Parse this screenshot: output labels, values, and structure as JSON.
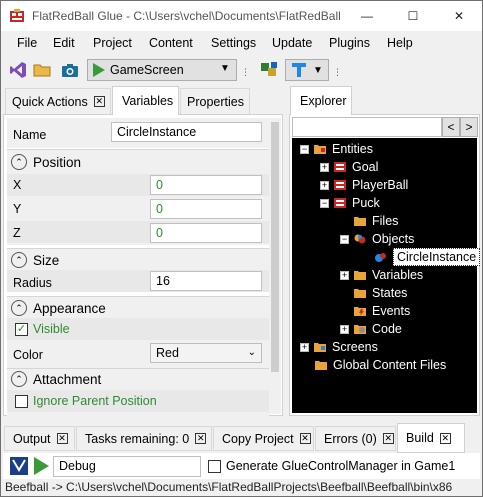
{
  "window": {
    "title": "FlatRedBall Glue - C:\\Users\\vchel\\Documents\\FlatRedBall",
    "minimize": "—",
    "maximize": "☐",
    "close": "✕"
  },
  "menu": [
    "File",
    "Edit",
    "Project",
    "Content",
    "Settings",
    "Update",
    "Plugins",
    "Help"
  ],
  "toolbar": {
    "screen_combo_value": "GameScreen"
  },
  "left_tabs": [
    {
      "label": "Quick Actions",
      "close": "✕"
    },
    {
      "label": "Variables"
    },
    {
      "label": "Properties"
    }
  ],
  "variables": {
    "name_label": "Name",
    "name_value": "CircleInstance",
    "position": {
      "header": "Position",
      "x_label": "X",
      "x_value": "0",
      "y_label": "Y",
      "y_value": "0",
      "z_label": "Z",
      "z_value": "0"
    },
    "size": {
      "header": "Size",
      "radius_label": "Radius",
      "radius_value": "16"
    },
    "appearance": {
      "header": "Appearance",
      "visible_label": "Visible",
      "visible_checked": true,
      "color_label": "Color",
      "color_value": "Red"
    },
    "attachment": {
      "header": "Attachment",
      "ignore_parent_label": "Ignore Parent Position",
      "ignore_parent_checked": false
    }
  },
  "explorer": {
    "tab_label": "Explorer",
    "search_placeholder": "",
    "back_label": "<",
    "forward_label": ">",
    "nodes": {
      "entities": "Entities",
      "goal": "Goal",
      "playerball": "PlayerBall",
      "puck": "Puck",
      "files": "Files",
      "objects": "Objects",
      "circleinstance": "CircleInstance",
      "variables": "Variables",
      "states": "States",
      "events": "Events",
      "code": "Code",
      "screens": "Screens",
      "global_content": "Global Content Files"
    }
  },
  "bottom_tabs": [
    {
      "label": "Output"
    },
    {
      "label": "Tasks remaining: 0"
    },
    {
      "label": "Copy Project"
    },
    {
      "label": "Errors (0)"
    },
    {
      "label": "Build"
    }
  ],
  "build": {
    "config_value": "Debug",
    "generate_label": "Generate GlueControlManager in Game1",
    "generate_checked": false
  },
  "status_text": "Beefball -> C:\\Users\\vchel\\Documents\\FlatRedBallProjects\\Beefball\\Beefball\\bin\\x86",
  "colors": {
    "accent_green": "#2f8b2f",
    "folder_orange": "#e8a33a",
    "red_icon": "#c62828",
    "tree_background": "#000000"
  }
}
